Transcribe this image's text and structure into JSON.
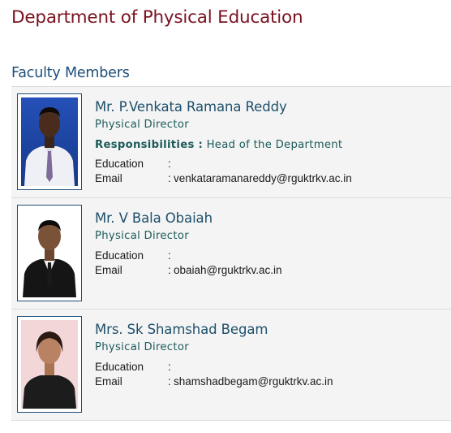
{
  "page": {
    "title": "Department of Physical Education",
    "section_title": "Faculty Members"
  },
  "labels": {
    "responsibilities": "Responsibilities :",
    "education": "Education",
    "email": "Email",
    "separator": ":"
  },
  "faculty": [
    {
      "name": "Mr. P.Venkata Ramana Reddy",
      "designation": "Physical Director",
      "responsibilities": "Head of the Department",
      "education": "",
      "email": "venkataramanareddy@rguktrkv.ac.in"
    },
    {
      "name": "Mr. V Bala Obaiah",
      "designation": "Physical Director",
      "education": "",
      "email": "obaiah@rguktrkv.ac.in"
    },
    {
      "name": "Mrs. Sk Shamshad Begam",
      "designation": "Physical Director",
      "education": "",
      "email": "shamshadbegam@rguktrkv.ac.in"
    }
  ],
  "colors": {
    "title": "#7a1320",
    "section": "#1d4f7a",
    "name": "#1d4f6b",
    "card_bg": "#f4f4f4"
  }
}
